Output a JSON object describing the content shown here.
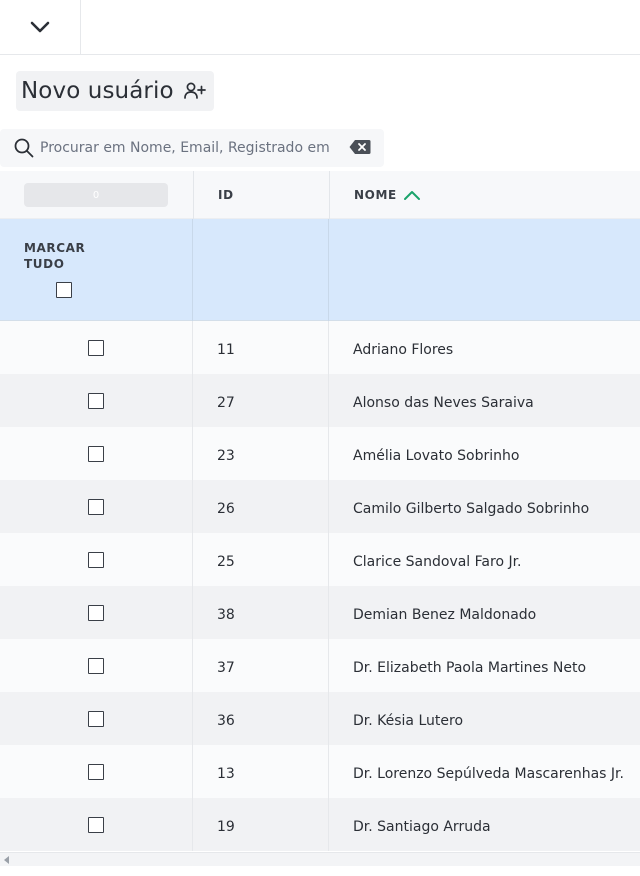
{
  "toolbar": {
    "collapse_icon": "chevron-down-icon",
    "new_user_label": "Novo usuário",
    "new_user_icon": "user-plus-icon"
  },
  "search": {
    "placeholder": "Procurar em Nome, Email, Registrado em",
    "value": "",
    "icon": "search-icon",
    "clear_icon": "backspace-icon"
  },
  "table": {
    "progress_label": "0",
    "columns": [
      {
        "key": "id",
        "label": "ID"
      },
      {
        "key": "nome",
        "label": "NOME",
        "sorted": "asc"
      }
    ],
    "select_all_label": "MARCAR TUDO",
    "rows": [
      {
        "id": "11",
        "nome": "Adriano Flores"
      },
      {
        "id": "27",
        "nome": "Alonso das Neves Saraiva"
      },
      {
        "id": "23",
        "nome": "Amélia Lovato Sobrinho"
      },
      {
        "id": "26",
        "nome": "Camilo Gilberto Salgado Sobrinho"
      },
      {
        "id": "25",
        "nome": "Clarice Sandoval Faro Jr."
      },
      {
        "id": "38",
        "nome": "Demian Benez Maldonado"
      },
      {
        "id": "37",
        "nome": "Dr. Elizabeth Paola Martines Neto"
      },
      {
        "id": "36",
        "nome": "Dr. Késia Lutero"
      },
      {
        "id": "13",
        "nome": "Dr. Lorenzo Sepúlveda Mascarenhas Jr."
      },
      {
        "id": "19",
        "nome": "Dr. Santiago Arruda"
      }
    ]
  },
  "colors": {
    "select_all_bg": "#d7e8fc",
    "sort_accent": "#1aa36b",
    "row_alt": "#f1f2f4"
  }
}
